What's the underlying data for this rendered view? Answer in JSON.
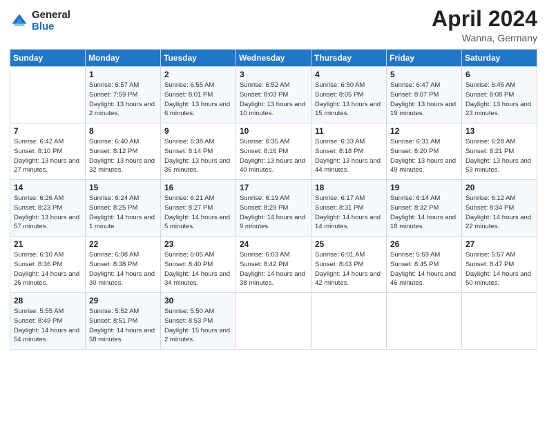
{
  "header": {
    "logo_general": "General",
    "logo_blue": "Blue",
    "title": "April 2024",
    "subtitle": "Wanna, Germany"
  },
  "days_of_week": [
    "Sunday",
    "Monday",
    "Tuesday",
    "Wednesday",
    "Thursday",
    "Friday",
    "Saturday"
  ],
  "weeks": [
    [
      {
        "day": "",
        "sunrise": "",
        "sunset": "",
        "daylight": ""
      },
      {
        "day": "1",
        "sunrise": "Sunrise: 6:57 AM",
        "sunset": "Sunset: 7:59 PM",
        "daylight": "Daylight: 13 hours and 2 minutes."
      },
      {
        "day": "2",
        "sunrise": "Sunrise: 6:55 AM",
        "sunset": "Sunset: 8:01 PM",
        "daylight": "Daylight: 13 hours and 6 minutes."
      },
      {
        "day": "3",
        "sunrise": "Sunrise: 6:52 AM",
        "sunset": "Sunset: 8:03 PM",
        "daylight": "Daylight: 13 hours and 10 minutes."
      },
      {
        "day": "4",
        "sunrise": "Sunrise: 6:50 AM",
        "sunset": "Sunset: 8:05 PM",
        "daylight": "Daylight: 13 hours and 15 minutes."
      },
      {
        "day": "5",
        "sunrise": "Sunrise: 6:47 AM",
        "sunset": "Sunset: 8:07 PM",
        "daylight": "Daylight: 13 hours and 19 minutes."
      },
      {
        "day": "6",
        "sunrise": "Sunrise: 6:45 AM",
        "sunset": "Sunset: 8:08 PM",
        "daylight": "Daylight: 13 hours and 23 minutes."
      }
    ],
    [
      {
        "day": "7",
        "sunrise": "Sunrise: 6:42 AM",
        "sunset": "Sunset: 8:10 PM",
        "daylight": "Daylight: 13 hours and 27 minutes."
      },
      {
        "day": "8",
        "sunrise": "Sunrise: 6:40 AM",
        "sunset": "Sunset: 8:12 PM",
        "daylight": "Daylight: 13 hours and 32 minutes."
      },
      {
        "day": "9",
        "sunrise": "Sunrise: 6:38 AM",
        "sunset": "Sunset: 8:14 PM",
        "daylight": "Daylight: 13 hours and 36 minutes."
      },
      {
        "day": "10",
        "sunrise": "Sunrise: 6:35 AM",
        "sunset": "Sunset: 8:16 PM",
        "daylight": "Daylight: 13 hours and 40 minutes."
      },
      {
        "day": "11",
        "sunrise": "Sunrise: 6:33 AM",
        "sunset": "Sunset: 8:18 PM",
        "daylight": "Daylight: 13 hours and 44 minutes."
      },
      {
        "day": "12",
        "sunrise": "Sunrise: 6:31 AM",
        "sunset": "Sunset: 8:20 PM",
        "daylight": "Daylight: 13 hours and 49 minutes."
      },
      {
        "day": "13",
        "sunrise": "Sunrise: 6:28 AM",
        "sunset": "Sunset: 8:21 PM",
        "daylight": "Daylight: 13 hours and 53 minutes."
      }
    ],
    [
      {
        "day": "14",
        "sunrise": "Sunrise: 6:26 AM",
        "sunset": "Sunset: 8:23 PM",
        "daylight": "Daylight: 13 hours and 57 minutes."
      },
      {
        "day": "15",
        "sunrise": "Sunrise: 6:24 AM",
        "sunset": "Sunset: 8:25 PM",
        "daylight": "Daylight: 14 hours and 1 minute."
      },
      {
        "day": "16",
        "sunrise": "Sunrise: 6:21 AM",
        "sunset": "Sunset: 8:27 PM",
        "daylight": "Daylight: 14 hours and 5 minutes."
      },
      {
        "day": "17",
        "sunrise": "Sunrise: 6:19 AM",
        "sunset": "Sunset: 8:29 PM",
        "daylight": "Daylight: 14 hours and 9 minutes."
      },
      {
        "day": "18",
        "sunrise": "Sunrise: 6:17 AM",
        "sunset": "Sunset: 8:31 PM",
        "daylight": "Daylight: 14 hours and 14 minutes."
      },
      {
        "day": "19",
        "sunrise": "Sunrise: 6:14 AM",
        "sunset": "Sunset: 8:32 PM",
        "daylight": "Daylight: 14 hours and 18 minutes."
      },
      {
        "day": "20",
        "sunrise": "Sunrise: 6:12 AM",
        "sunset": "Sunset: 8:34 PM",
        "daylight": "Daylight: 14 hours and 22 minutes."
      }
    ],
    [
      {
        "day": "21",
        "sunrise": "Sunrise: 6:10 AM",
        "sunset": "Sunset: 8:36 PM",
        "daylight": "Daylight: 14 hours and 26 minutes."
      },
      {
        "day": "22",
        "sunrise": "Sunrise: 6:08 AM",
        "sunset": "Sunset: 8:38 PM",
        "daylight": "Daylight: 14 hours and 30 minutes."
      },
      {
        "day": "23",
        "sunrise": "Sunrise: 6:05 AM",
        "sunset": "Sunset: 8:40 PM",
        "daylight": "Daylight: 14 hours and 34 minutes."
      },
      {
        "day": "24",
        "sunrise": "Sunrise: 6:03 AM",
        "sunset": "Sunset: 8:42 PM",
        "daylight": "Daylight: 14 hours and 38 minutes."
      },
      {
        "day": "25",
        "sunrise": "Sunrise: 6:01 AM",
        "sunset": "Sunset: 8:43 PM",
        "daylight": "Daylight: 14 hours and 42 minutes."
      },
      {
        "day": "26",
        "sunrise": "Sunrise: 5:59 AM",
        "sunset": "Sunset: 8:45 PM",
        "daylight": "Daylight: 14 hours and 46 minutes."
      },
      {
        "day": "27",
        "sunrise": "Sunrise: 5:57 AM",
        "sunset": "Sunset: 8:47 PM",
        "daylight": "Daylight: 14 hours and 50 minutes."
      }
    ],
    [
      {
        "day": "28",
        "sunrise": "Sunrise: 5:55 AM",
        "sunset": "Sunset: 8:49 PM",
        "daylight": "Daylight: 14 hours and 54 minutes."
      },
      {
        "day": "29",
        "sunrise": "Sunrise: 5:52 AM",
        "sunset": "Sunset: 8:51 PM",
        "daylight": "Daylight: 14 hours and 58 minutes."
      },
      {
        "day": "30",
        "sunrise": "Sunrise: 5:50 AM",
        "sunset": "Sunset: 8:53 PM",
        "daylight": "Daylight: 15 hours and 2 minutes."
      },
      {
        "day": "",
        "sunrise": "",
        "sunset": "",
        "daylight": ""
      },
      {
        "day": "",
        "sunrise": "",
        "sunset": "",
        "daylight": ""
      },
      {
        "day": "",
        "sunrise": "",
        "sunset": "",
        "daylight": ""
      },
      {
        "day": "",
        "sunrise": "",
        "sunset": "",
        "daylight": ""
      }
    ]
  ]
}
